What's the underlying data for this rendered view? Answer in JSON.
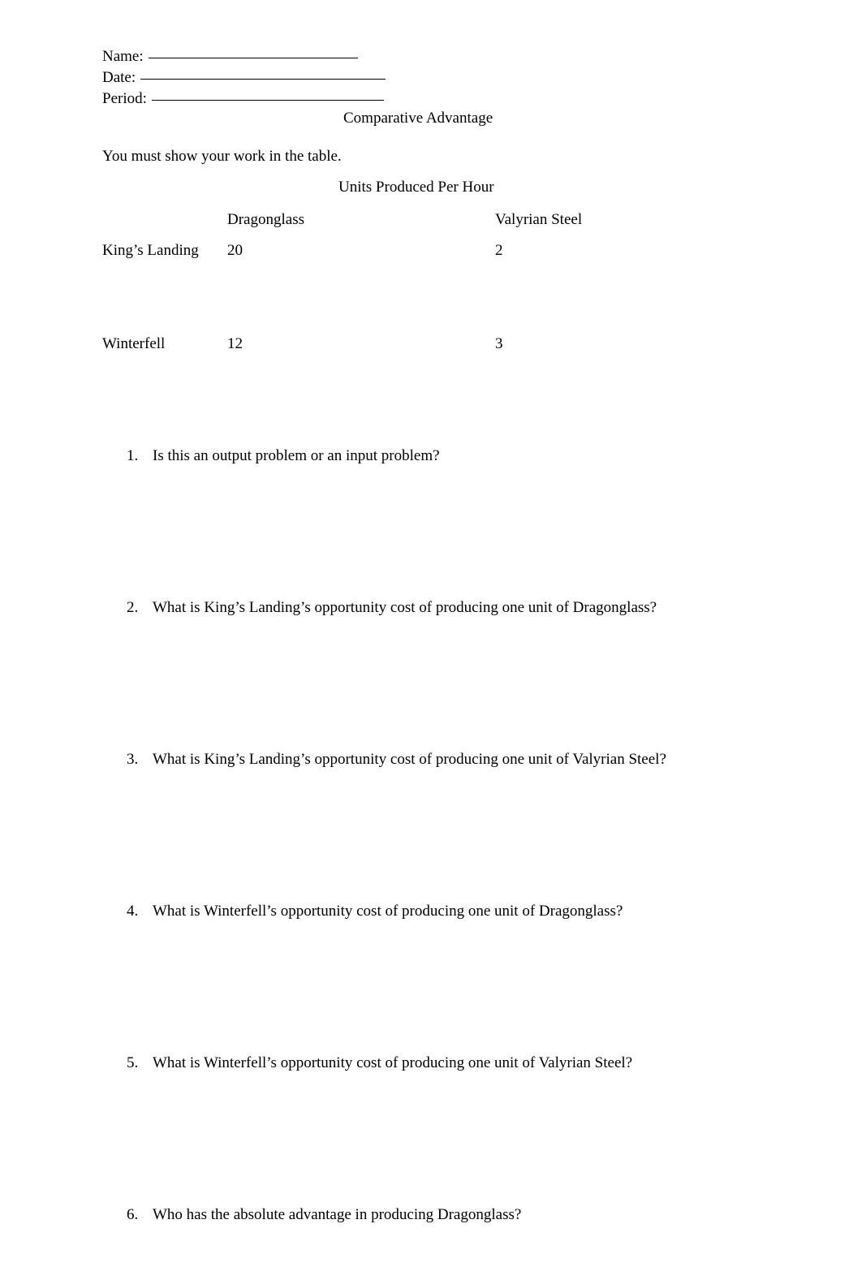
{
  "document": {
    "title": "Comparative Advantage",
    "instruction": "You must show your work in the table."
  },
  "header_fields": [
    {
      "label": "Name:",
      "value": ""
    },
    {
      "label": "Date:",
      "value": ""
    },
    {
      "label": "Period:",
      "value": ""
    }
  ],
  "table": {
    "caption": "Units Produced Per Hour",
    "corner_header": "",
    "column_headers": [
      "Dragonglass",
      "Valyrian Steel"
    ],
    "rows": [
      {
        "region": "King’s Landing",
        "dragonglass": "20",
        "valyrian_steel": "2"
      },
      {
        "region": "Winterfell",
        "dragonglass": "12",
        "valyrian_steel": "3"
      }
    ]
  },
  "questions": [
    {
      "number": "1.",
      "text": "Is this an output problem or an input problem?"
    },
    {
      "number": "2.",
      "text": "What is King’s Landing’s opportunity cost of producing one unit of Dragonglass?"
    },
    {
      "number": "3.",
      "text": "What is King’s Landing’s opportunity cost of producing one unit of Valyrian Steel?"
    },
    {
      "number": "4.",
      "text": "What is Winterfell’s opportunity cost of producing one unit of Dragonglass?"
    },
    {
      "number": "5.",
      "text": "What is Winterfell’s opportunity cost of producing one unit of Valyrian Steel?"
    },
    {
      "number": "6.",
      "text": "Who has the absolute advantage in producing Dragonglass?"
    }
  ]
}
